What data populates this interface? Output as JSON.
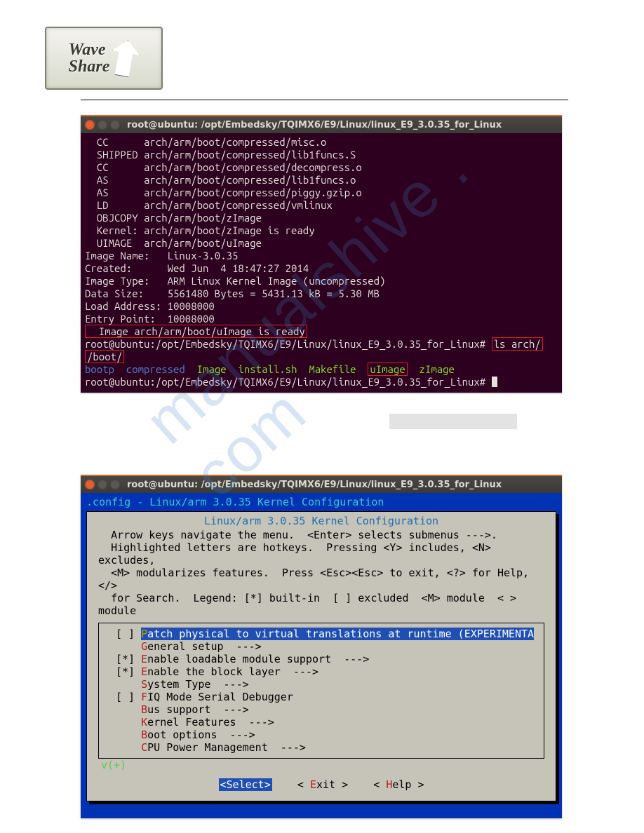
{
  "logo": {
    "line1": "Wave",
    "line2": "Share",
    "small": "W"
  },
  "watermark": "manualshive . com",
  "titlebar": "root@ubuntu: /opt/Embedsky/TQIMX6/E9/Linux/linux_E9_3.0.35_for_Linux",
  "compile": {
    "lines": [
      "  CC      arch/arm/boot/compressed/misc.o",
      "  SHIPPED arch/arm/boot/compressed/lib1funcs.S",
      "  CC      arch/arm/boot/compressed/decompress.o",
      "  AS      arch/arm/boot/compressed/lib1funcs.o",
      "  AS      arch/arm/boot/compressed/piggy.gzip.o",
      "  LD      arch/arm/boot/compressed/vmlinux",
      "  OBJCOPY arch/arm/boot/zImage",
      "  Kernel: arch/arm/boot/zImage is ready",
      "  UIMAGE  arch/arm/boot/uImage",
      "Image Name:   Linux-3.0.35",
      "Created:      Wed Jun  4 18:47:27 2014",
      "Image Type:   ARM Linux Kernel Image (uncompressed)",
      "Data Size:    5561480 Bytes = 5431.13 kB = 5.30 MB",
      "Load Address: 10008000",
      "Entry Point:  10008000"
    ],
    "ready_boxed": "  Image arch/arm/boot/uImage is ready",
    "prompt_path": "root@ubuntu:/opt/Embedsky/TQIMX6/E9/Linux/linux_E9_3.0.35_for_Linux#",
    "cmd_ls_1": "ls arch/",
    "cmd_ls_2": "/boot/",
    "ls_bootp": "bootp",
    "ls_compressed": "compressed",
    "ls_image": "Image",
    "ls_install": "install.sh",
    "ls_makefile": "Makefile",
    "ls_uimage": "uImage",
    "ls_zimage": "zImage"
  },
  "menuconfig": {
    "topline": ".config - Linux/arm 3.0.35 Kernel Configuration",
    "inner_title": "Linux/arm 3.0.35 Kernel Configuration",
    "help": "  Arrow keys navigate the menu.  <Enter> selects submenus --->.\n  Highlighted letters are hotkeys.  Pressing <Y> includes, <N> excludes,\n  <M> modularizes features.  Press <Esc><Esc> to exit, <?> for Help, </> \n  for Search.  Legend: [*] built-in  [ ] excluded  <M> module  < > module",
    "items": [
      {
        "mark": "[ ]",
        "hk": "P",
        "rest": "atch physical to virtual translations at runtime (EXPERIMENTA",
        "hi": true
      },
      {
        "mark": "   ",
        "hk": "G",
        "rest": "eneral setup  --->"
      },
      {
        "mark": "[*]",
        "hk": "E",
        "rest": "nable loadable module support  --->"
      },
      {
        "mark": "[*]",
        "hk": "E",
        "rest": "nable the block layer  --->"
      },
      {
        "mark": "   ",
        "hk": "S",
        "rest": "ystem Type  --->"
      },
      {
        "mark": "[ ]",
        "hk": "F",
        "rest": "IQ Mode Serial Debugger"
      },
      {
        "mark": "   ",
        "hk": "B",
        "rest": "us support  --->"
      },
      {
        "mark": "   ",
        "hk": "K",
        "rest": "ernel Features  --->"
      },
      {
        "mark": "   ",
        "hk": "B",
        "rest": "oot options  --->"
      },
      {
        "mark": "   ",
        "hk": "C",
        "rest": "PU Power Management  --->"
      }
    ],
    "vplus": "v(+)",
    "btn_select": "<Select>",
    "btn_exit_pre": "< ",
    "btn_exit_hk": "E",
    "btn_exit_post": "xit >",
    "btn_help_pre": "< ",
    "btn_help_hk": "H",
    "btn_help_post": "elp >"
  }
}
